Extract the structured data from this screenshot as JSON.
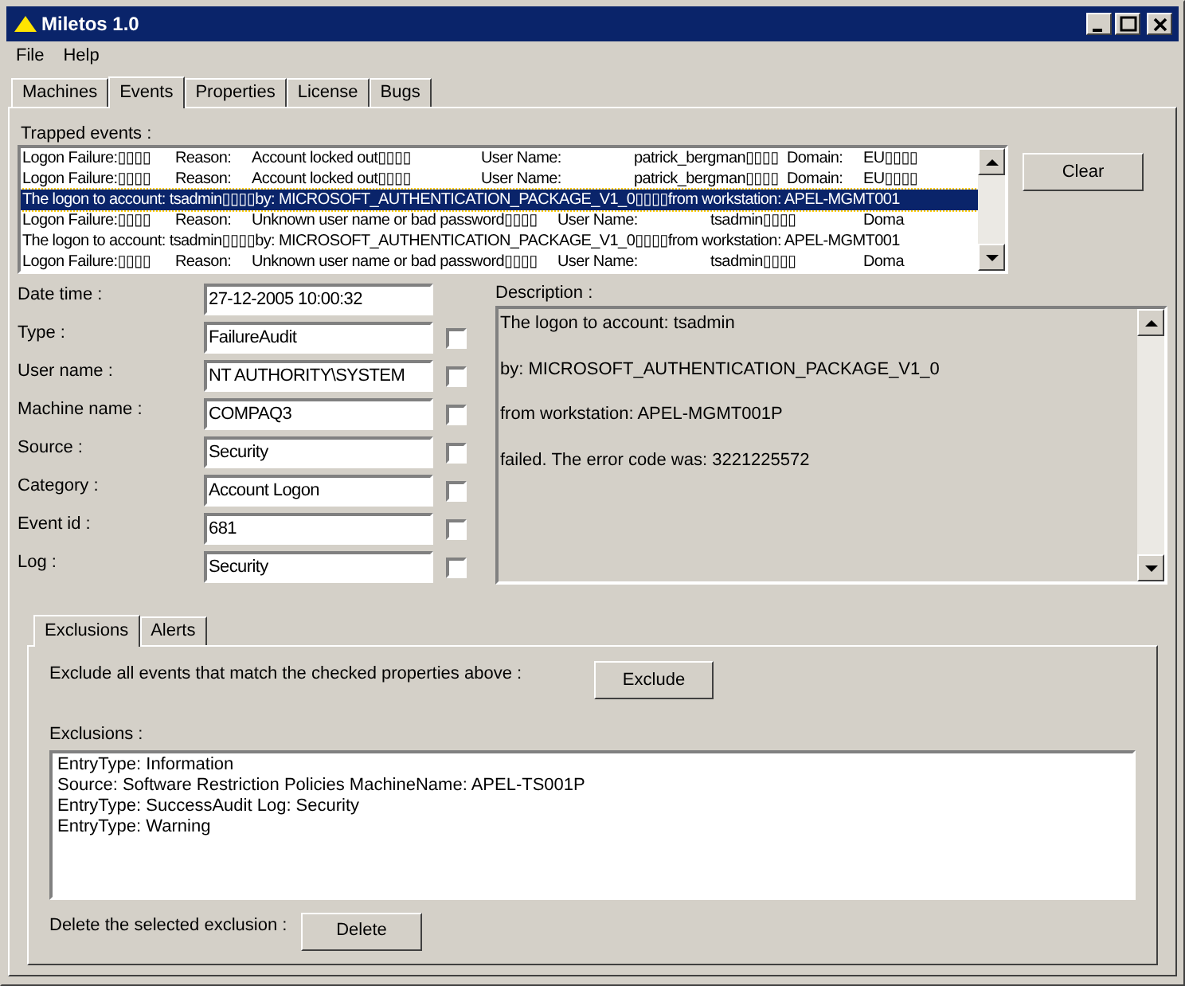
{
  "window": {
    "title": "Miletos 1.0"
  },
  "menu": [
    "File",
    "Help"
  ],
  "tabs": [
    {
      "label": "Machines",
      "selected": false
    },
    {
      "label": "Events",
      "selected": true
    },
    {
      "label": "Properties",
      "selected": false
    },
    {
      "label": "License",
      "selected": false
    },
    {
      "label": "Bugs",
      "selected": false
    }
  ],
  "trapped_events": {
    "label": "Trapped events :",
    "rows": [
      {
        "selected": false,
        "cells": [
          "Logon Failure:▯▯▯▯",
          "Reason:",
          "Account locked out▯▯▯▯",
          "User Name:",
          "patrick_bergman▯▯▯▯",
          "Domain:",
          "EU▯▯▯▯"
        ]
      },
      {
        "selected": false,
        "cells": [
          "Logon Failure:▯▯▯▯",
          "Reason:",
          "Account locked out▯▯▯▯",
          "User Name:",
          "patrick_bergman▯▯▯▯",
          "Domain:",
          "EU▯▯▯▯"
        ]
      },
      {
        "selected": true,
        "cells": [
          "The logon to account: tsadmin▯▯▯▯by: MICROSOFT_AUTHENTICATION_PACKAGE_V1_0▯▯▯▯from workstation: APEL-MGMT001"
        ]
      },
      {
        "selected": false,
        "cells": [
          "Logon Failure:▯▯▯▯",
          "Reason:",
          "Unknown user name or bad password▯▯▯▯",
          "User Name:",
          "tsadmin▯▯▯▯",
          "Doma"
        ]
      },
      {
        "selected": false,
        "cells": [
          "The logon to account: tsadmin▯▯▯▯by: MICROSOFT_AUTHENTICATION_PACKAGE_V1_0▯▯▯▯from workstation: APEL-MGMT001"
        ]
      },
      {
        "selected": false,
        "cells": [
          "Logon Failure:▯▯▯▯",
          "Reason:",
          "Unknown user name or bad password▯▯▯▯",
          "User Name:",
          "tsadmin▯▯▯▯",
          "Doma"
        ]
      }
    ]
  },
  "clear_button": "Clear",
  "properties": [
    {
      "kind": "plain",
      "label": "Date time :",
      "value": "27-12-2005 10:00:32"
    },
    {
      "kind": "checkable",
      "label": "Type :",
      "value": "FailureAudit",
      "checked": false
    },
    {
      "kind": "checkable",
      "label": "User name :",
      "value": "NT AUTHORITY\\SYSTEM",
      "checked": false
    },
    {
      "kind": "checkable",
      "label": "Machine name :",
      "value": "COMPAQ3",
      "checked": false
    },
    {
      "kind": "checkable",
      "label": "Source :",
      "value": "Security",
      "checked": false
    },
    {
      "kind": "checkable",
      "label": "Category :",
      "value": "Account Logon",
      "checked": false
    },
    {
      "kind": "checkable",
      "label": "Event id :",
      "value": "681",
      "checked": false
    },
    {
      "kind": "checkable",
      "label": "Log :",
      "value": "Security",
      "checked": false
    }
  ],
  "description": {
    "label": "Description :",
    "lines": [
      "The logon to account: tsadmin",
      "by: MICROSOFT_AUTHENTICATION_PACKAGE_V1_0",
      "from workstation: APEL-MGMT001P",
      "failed. The error code was: 3221225572"
    ]
  },
  "bottom_tabs": [
    {
      "label": "Exclusions",
      "selected": true
    },
    {
      "label": "Alerts",
      "selected": false
    }
  ],
  "exclude_text": "Exclude all events that match the checked properties above :",
  "exclude_button": "Exclude",
  "exclusions": {
    "label": "Exclusions :",
    "items": [
      "EntryType: Information",
      "Source: Software Restriction Policies MachineName: APEL-TS001P",
      "EntryType: SuccessAudit Log: Security",
      "EntryType: Warning"
    ]
  },
  "delete_text": "Delete the selected exclusion :",
  "delete_button": "Delete"
}
